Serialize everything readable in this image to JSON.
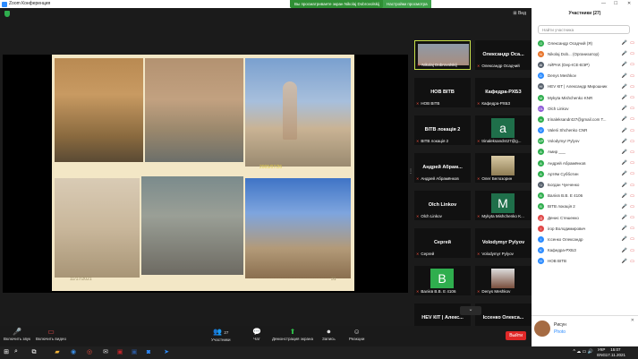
{
  "window": {
    "title": "Zoom Конференция",
    "banner": "Вы просматриваете экран Nikolaj Dobrovolskij",
    "banner_button": "Настройки просмотра",
    "view_label": "Вид"
  },
  "slide": {
    "date_stamp": "2005/07/26",
    "footer_date": "11/17/2021",
    "page_number": "31"
  },
  "tiles": [
    {
      "name": "",
      "label": "Nikolaj Dobrovolskij",
      "avatar": "photo"
    },
    {
      "name": "Олександр Оса...",
      "label": "Олександр Осадчий",
      "avatar": ""
    },
    {
      "name": "НОВ ВІТВ",
      "label": "НОВ ВІТВ",
      "avatar": ""
    },
    {
      "name": "Кафедра-РХБЗ",
      "label": "Кафедра-РХБЗ",
      "avatar": ""
    },
    {
      "name": "ВІТВ локація 2",
      "label": "ВІТВ локація 2",
      "avatar": ""
    },
    {
      "name": "",
      "label": "trinaleksandr427@g...",
      "avatar": "a"
    },
    {
      "name": "Андрей Абрам...",
      "label": "Андрей Абрамёнков",
      "avatar": ""
    },
    {
      "name": "",
      "label": "Олег Белозорин",
      "avatar": "photo2"
    },
    {
      "name": "Olch Linkov",
      "label": "Olch Linkov",
      "avatar": ""
    },
    {
      "name": "",
      "label": "Mykyta Mishchenko K...",
      "avatar": "M"
    },
    {
      "name": "Сергей",
      "label": "Сергей",
      "avatar": ""
    },
    {
      "name": "Volodymyr Pylyov",
      "label": "Volodymyr Pylyov",
      "avatar": ""
    },
    {
      "name": "",
      "label": "Валієв В.В. Е 4106",
      "avatar": "B"
    },
    {
      "name": "",
      "label": "Denys Meshkov",
      "avatar": "photo3"
    },
    {
      "name": "HEV КIT | Алекс...",
      "label": "HEV КIT | Александр...",
      "avatar": ""
    },
    {
      "name": "Іссенко Олекса...",
      "label": "Іссенко Олександр",
      "avatar": ""
    }
  ],
  "toolbar": {
    "mic": "Включить звук",
    "video": "Включить видео",
    "participants": "Участники",
    "participants_count": "27",
    "chat": "Чат",
    "share": "Демонстрация экрана",
    "record": "Запись",
    "reactions": "Реакции",
    "leave": "Выйти"
  },
  "panel": {
    "title": "Участники (27)",
    "search_placeholder": "Найти участника",
    "participants": [
      {
        "initial": "O",
        "color": "#2fae4e",
        "name": "Олександр Осадчий (Я)"
      },
      {
        "initial": "N",
        "color": "#e8742b",
        "name": "Nikolaj Dob... (Организатор)"
      },
      {
        "initial": "AI",
        "color": "#555f6b",
        "name": "АЙРАК (Dep-ICE-ВЭР)"
      },
      {
        "initial": "D",
        "color": "#2d8cff",
        "name": "Denys Meshkov"
      },
      {
        "initial": "HI",
        "color": "#555f6b",
        "name": "HEV КIT | Александр Мирошник"
      },
      {
        "initial": "M",
        "color": "#2fae4e",
        "name": "Mykyta Mishchenko KNR"
      },
      {
        "initial": "OL",
        "color": "#8e5bd6",
        "name": "Olch Linkov"
      },
      {
        "initial": "a",
        "color": "#2fae4e",
        "name": "trinaleksandr427@gmail.com T..."
      },
      {
        "initial": "V",
        "color": "#2d8cff",
        "name": "Valerii Shchenko CNR"
      },
      {
        "initial": "VP",
        "color": "#2fae4e",
        "name": "Volodymyr Pylyov"
      },
      {
        "initial": "A",
        "color": "#2fae4e",
        "name": "Амир ___"
      },
      {
        "initial": "A",
        "color": "#2fae4e",
        "name": "Андрей Абрамёнков"
      },
      {
        "initial": "A",
        "color": "#2fae4e",
        "name": "Артём Субботин"
      },
      {
        "initial": "Ч",
        "color": "#555f6b",
        "name": "Богдан Чунченко"
      },
      {
        "initial": "B",
        "color": "#2fae4e",
        "name": "Валієв В.В. Е 4106"
      },
      {
        "initial": "B",
        "color": "#2fae4e",
        "name": "ВІТВ локація 2"
      },
      {
        "initial": "Д",
        "color": "#e04848",
        "name": "Денис Стешенко"
      },
      {
        "initial": "i",
        "color": "#e04848",
        "name": "ігор Володимирович"
      },
      {
        "initial": "i",
        "color": "#2d8cff",
        "name": "Іссенко Олександр"
      },
      {
        "initial": "K",
        "color": "#2d8cff",
        "name": "Кафедра-РХБЗ"
      },
      {
        "initial": "H",
        "color": "#2d8cff",
        "name": "НОВ ВІТВ"
      }
    ]
  },
  "notification": {
    "name": "Рисун",
    "text": "Photo"
  },
  "taskbar": {
    "lang_top": "УКР",
    "lang_bottom": "ENG",
    "time": "15:07",
    "date": "17.11.2021"
  }
}
